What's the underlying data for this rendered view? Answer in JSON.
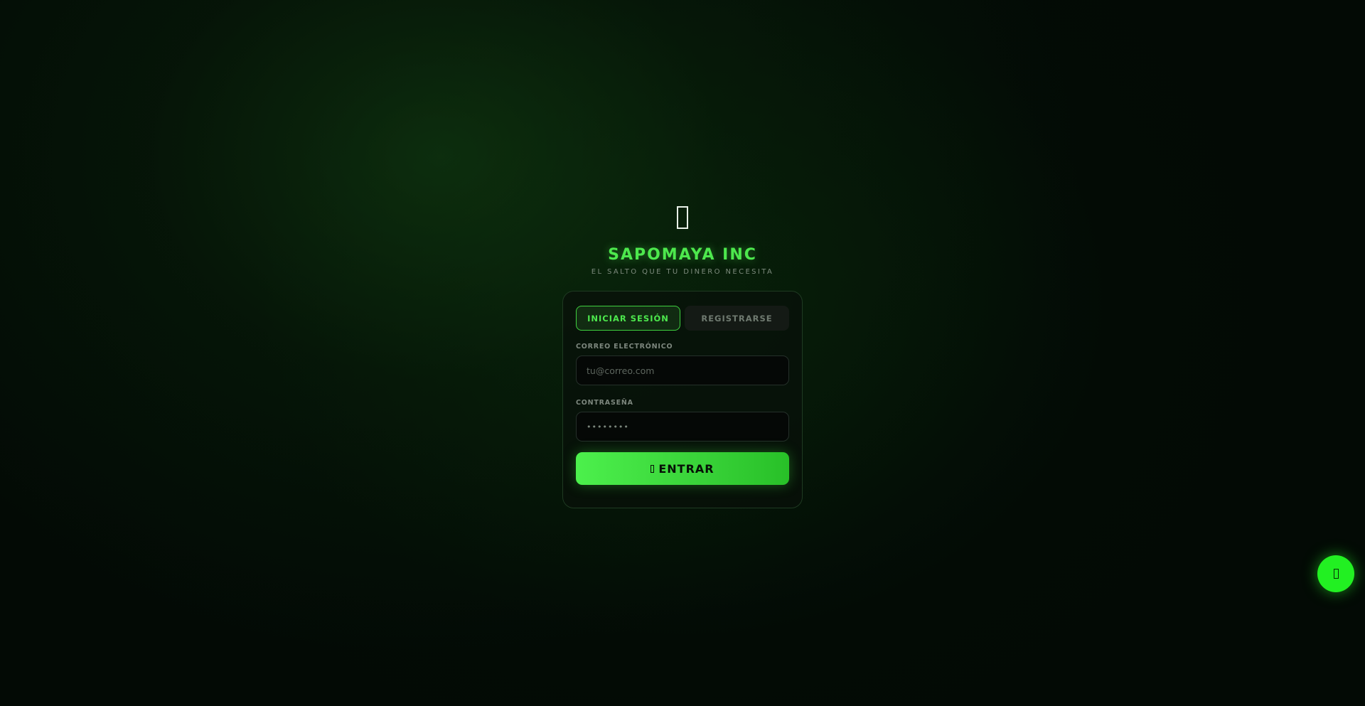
{
  "brand": {
    "logo_icon": "frog-icon",
    "title": "SAPOMAYA INC",
    "tagline": "EL SALTO QUE TU DINERO NECESITA",
    "accent_color": "#4de84d"
  },
  "auth_tabs": {
    "login_label": "INICIAR SESIÓN",
    "register_label": "REGISTRARSE",
    "active": "login"
  },
  "form": {
    "email_label": "CORREO ELECTRÓNICO",
    "email_placeholder": "tu@correo.com",
    "password_label": "CONTRASEÑA",
    "password_placeholder": "••••••••",
    "submit_label": "ENTRAR",
    "submit_icon": "login-icon"
  },
  "fab": {
    "icon": "chat-icon",
    "color": "#22f022"
  }
}
